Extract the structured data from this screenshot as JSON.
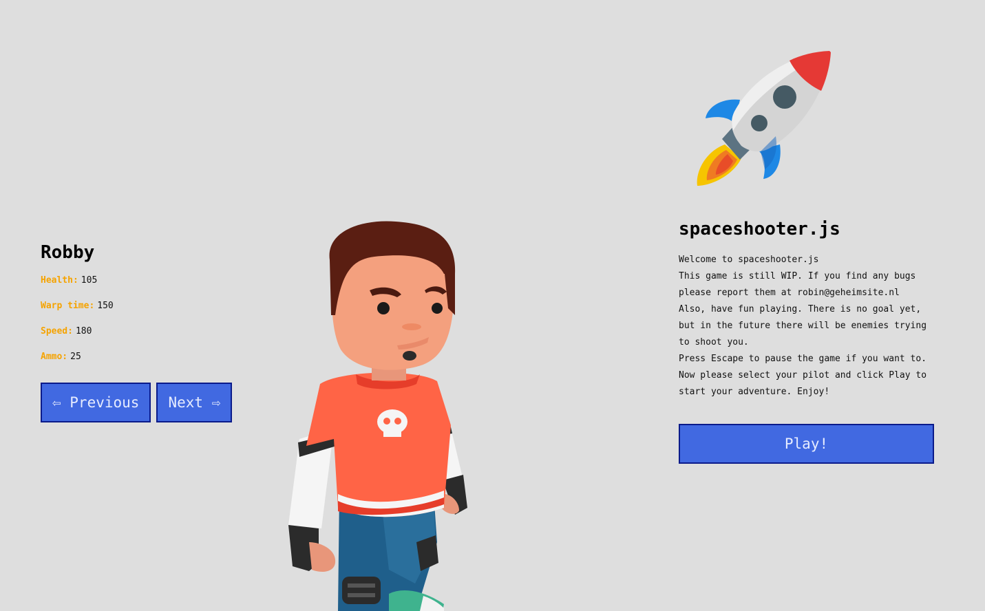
{
  "pilot": {
    "name": "Robby",
    "stats": [
      {
        "label": "Health:",
        "value": "105"
      },
      {
        "label": "Warp time:",
        "value": "150"
      },
      {
        "label": "Speed:",
        "value": "180"
      },
      {
        "label": "Ammo:",
        "value": "25"
      }
    ],
    "previous_label": "⇦ Previous",
    "next_label": "Next ⇨"
  },
  "game": {
    "title": "spaceshooter.js",
    "description": "Welcome to spaceshooter.js\nThis game is still WIP. If you find any bugs please report them at robin@geheimsite.nl\nAlso, have fun playing. There is no goal yet, but in the future there will be enemies trying to shoot you.\nPress Escape to pause the game if you want to.\nNow please select your pilot and click Play to start your adventure. Enjoy!",
    "play_label": "Play!"
  },
  "icons": {
    "logo": "rocket-icon",
    "character": "pilot-character"
  },
  "colors": {
    "background": "#dedede",
    "button": "#4169e1",
    "button_border": "#0a1a8a",
    "stat_label": "#f5a300"
  }
}
